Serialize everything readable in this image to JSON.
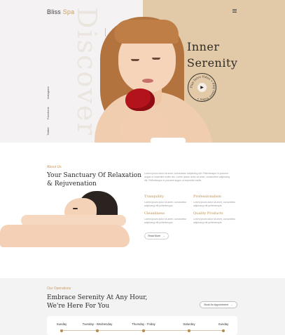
{
  "brand": {
    "name": "Bliss",
    "accent": "Spa"
  },
  "hero": {
    "watermark": "Discover",
    "title_line1": "Inner",
    "title_line2": "Serenity",
    "badge_text": "Play Intro Video • Play Intro Video •",
    "play_icon": "▶",
    "social": [
      "Twitter",
      "Facebook",
      "Instagram"
    ]
  },
  "about": {
    "eyebrow": "About Us",
    "title": "Your Sanctuary Of Relaxation & Rejuvenation",
    "text": "Lorem ipsum dolor sit amet, consectetur adipiscing elit. Pellentesque in posuere augue ut imperdiet mollis nisi. Lorem ipsum dolor sit amet, consectetur adipiscing elit. Pellentesque in posuere augue ut imperdiet mollis.",
    "features": [
      {
        "title": "Tranquility",
        "text": "Lorem ipsum dolor sit amet, consectetur adipiscing elit pellentesque."
      },
      {
        "title": "Professionalism",
        "text": "Lorem ipsum dolor sit amet, consectetur adipiscing elit pellentesque."
      },
      {
        "title": "Cleanliness",
        "text": "Lorem ipsum dolor sit amet, consectetur adipiscing elit pellentesque."
      },
      {
        "title": "Quality Products",
        "text": "Lorem ipsum dolor sit amet, consectetur adipiscing elit pellentesque."
      }
    ],
    "read_more": "Read More",
    "arrow": "→"
  },
  "operations": {
    "eyebrow": "Our Operations",
    "title": "Embrace Serenity At Any Hour, We're Here For You",
    "button": "Book An Appointment",
    "arrow": "→",
    "days": [
      "Sunday",
      "Tuesday - Wednesday",
      "Thursday - Friday",
      "Saturday",
      "Sunday"
    ]
  },
  "colors": {
    "accent": "#c69b5d",
    "hero_panel": "#e2c9a7",
    "rose": "#b3131b"
  }
}
